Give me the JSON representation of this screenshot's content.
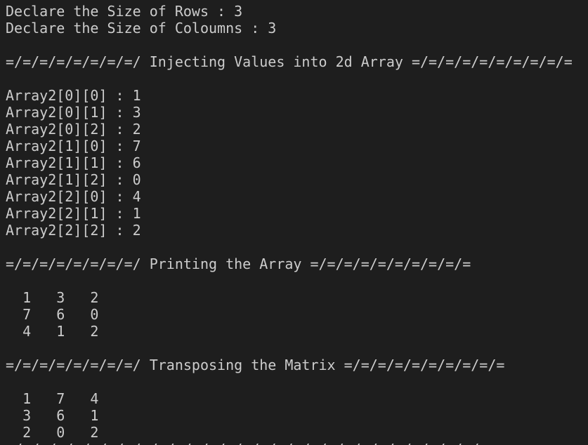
{
  "terminal": {
    "lines": [
      "Declare the Size of Rows : 3",
      "Declare the Size of Coloumns : 3",
      "",
      "=/=/=/=/=/=/=/=/ Injecting Values into 2d Array =/=/=/=/=/=/=/=/=/=",
      "",
      "Array2[0][0] : 1",
      "Array2[0][1] : 3",
      "Array2[0][2] : 2",
      "Array2[1][0] : 7",
      "Array2[1][1] : 6",
      "Array2[1][2] : 0",
      "Array2[2][0] : 4",
      "Array2[2][1] : 1",
      "Array2[2][2] : 2",
      "",
      "=/=/=/=/=/=/=/=/ Printing the Array =/=/=/=/=/=/=/=/=/=",
      "",
      "  1   3   2",
      "  7   6   0",
      "  4   1   2",
      "",
      "=/=/=/=/=/=/=/=/ Transposing the Matrix =/=/=/=/=/=/=/=/=/=",
      "",
      "  1   7   4",
      "  3   6   1",
      "  2   0   2",
      "=/=/=/=/=/=/=/=/=/=/=/=/=/=/=/=/=/=/=/=/=/=/=/=/=/=/=/=/="
    ]
  }
}
